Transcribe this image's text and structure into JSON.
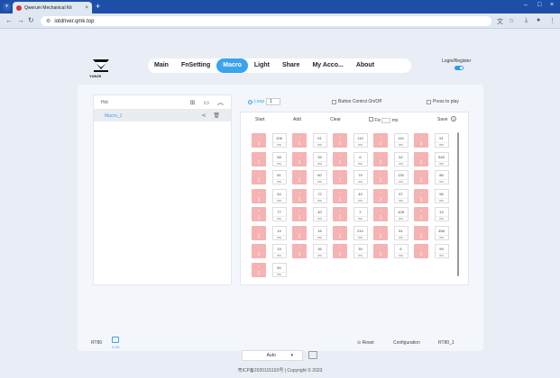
{
  "browser": {
    "tab_title": "Qwerum Mechanical Kit",
    "url": "iotdriver.qmk.top"
  },
  "header": {
    "logo_text": "YUNZII",
    "nav": [
      {
        "label": "Main",
        "active": false
      },
      {
        "label": "FnSetting",
        "active": false
      },
      {
        "label": "Macro",
        "active": true
      },
      {
        "label": "Light",
        "active": false
      },
      {
        "label": "Share",
        "active": false
      },
      {
        "label": "My Acco...",
        "active": false
      },
      {
        "label": "About",
        "active": false
      }
    ],
    "login_label": "Login/Register"
  },
  "macro_list": {
    "header_label": "Hot",
    "items": [
      {
        "name": "Macro_1"
      }
    ]
  },
  "controls": {
    "loop_label": "Loop",
    "loop_value": "1",
    "button_control_label": "Button Control On/Off",
    "press_to_play_label": "Press to play"
  },
  "toolbar": {
    "start": "Start",
    "add": "Add",
    "clear": "Clear",
    "fix": "Fix",
    "ms": "ms",
    "save": "Save",
    "help": "?"
  },
  "steps": [
    {
      "kind": "key",
      "dir": "↓",
      "key": "1"
    },
    {
      "kind": "delay",
      "value": "106",
      "unit": "ms"
    },
    {
      "kind": "key",
      "dir": "↓",
      "key": "1"
    },
    {
      "kind": "delay",
      "value": "91",
      "unit": "ms"
    },
    {
      "kind": "key",
      "dir": "↓",
      "key": "1"
    },
    {
      "kind": "delay",
      "value": "110",
      "unit": "ms"
    },
    {
      "kind": "key",
      "dir": "↓",
      "key": "1"
    },
    {
      "kind": "delay",
      "value": "110",
      "unit": "ms"
    },
    {
      "kind": "key",
      "dir": "↓",
      "key": "1"
    },
    {
      "kind": "delay",
      "value": "51",
      "unit": "ms"
    },
    {
      "kind": "key",
      "dir": "↓",
      "key": "1"
    },
    {
      "kind": "delay",
      "value": "58",
      "unit": "ms"
    },
    {
      "kind": "key",
      "dir": "↓",
      "key": "1"
    },
    {
      "kind": "delay",
      "value": "39",
      "unit": "ms"
    },
    {
      "kind": "key",
      "dir": "↓",
      "key": "1"
    },
    {
      "kind": "delay",
      "value": "6",
      "unit": "ms"
    },
    {
      "kind": "key",
      "dir": "↓",
      "key": "1"
    },
    {
      "kind": "delay",
      "value": "52",
      "unit": "ms"
    },
    {
      "kind": "key",
      "dir": "↓",
      "key": "1"
    },
    {
      "kind": "delay",
      "value": "545",
      "unit": "ms"
    },
    {
      "kind": "key",
      "dir": "↓",
      "key": "1"
    },
    {
      "kind": "delay",
      "value": "81",
      "unit": "ms"
    },
    {
      "kind": "key",
      "dir": "↓",
      "key": "1"
    },
    {
      "kind": "delay",
      "value": "60",
      "unit": "ms"
    },
    {
      "kind": "key",
      "dir": "↓",
      "key": "1"
    },
    {
      "kind": "delay",
      "value": "79",
      "unit": "ms"
    },
    {
      "kind": "key",
      "dir": "↓",
      "key": "1"
    },
    {
      "kind": "delay",
      "value": "130",
      "unit": "ms"
    },
    {
      "kind": "key",
      "dir": "↓",
      "key": "1"
    },
    {
      "kind": "delay",
      "value": "86",
      "unit": "ms"
    },
    {
      "kind": "key",
      "dir": "↓",
      "key": "1"
    },
    {
      "kind": "delay",
      "value": "54",
      "unit": "ms"
    },
    {
      "kind": "key",
      "dir": "↓",
      "key": "1"
    },
    {
      "kind": "delay",
      "value": "72",
      "unit": "ms"
    },
    {
      "kind": "key",
      "dir": "↓",
      "key": "1"
    },
    {
      "kind": "delay",
      "value": "49",
      "unit": "ms"
    },
    {
      "kind": "key",
      "dir": "↓",
      "key": "1"
    },
    {
      "kind": "delay",
      "value": "57",
      "unit": "ms"
    },
    {
      "kind": "key",
      "dir": "↓",
      "key": "1"
    },
    {
      "kind": "delay",
      "value": "56",
      "unit": "ms"
    },
    {
      "kind": "key",
      "dir": "↓",
      "key": "1"
    },
    {
      "kind": "delay",
      "value": "77",
      "unit": "ms"
    },
    {
      "kind": "key",
      "dir": "↓",
      "key": "1"
    },
    {
      "kind": "delay",
      "value": "40",
      "unit": "ms"
    },
    {
      "kind": "key",
      "dir": "↓",
      "key": "1"
    },
    {
      "kind": "delay",
      "value": "2",
      "unit": "ms"
    },
    {
      "kind": "key",
      "dir": "↓",
      "key": "1"
    },
    {
      "kind": "delay",
      "value": "108",
      "unit": "ms"
    },
    {
      "kind": "key",
      "dir": "↓",
      "key": "1"
    },
    {
      "kind": "delay",
      "value": "19",
      "unit": "ms"
    },
    {
      "kind": "key",
      "dir": "↓",
      "key": "1"
    },
    {
      "kind": "delay",
      "value": "19",
      "unit": "ms"
    },
    {
      "kind": "key",
      "dir": "↓",
      "key": "1"
    },
    {
      "kind": "delay",
      "value": "16",
      "unit": "ms"
    },
    {
      "kind": "key",
      "dir": "↓",
      "key": "1"
    },
    {
      "kind": "delay",
      "value": "210",
      "unit": "ms"
    },
    {
      "kind": "key",
      "dir": "↓",
      "key": "1"
    },
    {
      "kind": "delay",
      "value": "81",
      "unit": "ms"
    },
    {
      "kind": "key",
      "dir": "↓",
      "key": "1"
    },
    {
      "kind": "delay",
      "value": "458",
      "unit": "ms"
    },
    {
      "kind": "key",
      "dir": "↓",
      "key": "1"
    },
    {
      "kind": "delay",
      "value": "19",
      "unit": "ms"
    },
    {
      "kind": "key",
      "dir": "↓",
      "key": "1"
    },
    {
      "kind": "delay",
      "value": "36",
      "unit": "ms"
    },
    {
      "kind": "key",
      "dir": "↓",
      "key": "1"
    },
    {
      "kind": "delay",
      "value": "39",
      "unit": "ms"
    },
    {
      "kind": "key",
      "dir": "↓",
      "key": "1"
    },
    {
      "kind": "delay",
      "value": "6",
      "unit": "ms"
    },
    {
      "kind": "key",
      "dir": "↓",
      "key": "1"
    },
    {
      "kind": "delay",
      "value": "59",
      "unit": "ms"
    },
    {
      "kind": "key",
      "dir": "↓",
      "key": "1"
    },
    {
      "kind": "delay",
      "value": "50",
      "unit": "ms"
    }
  ],
  "footer": {
    "device": "RT80",
    "dongle_label": "2.4G",
    "reset": "Reset",
    "configuration": "Configuration",
    "config_value": "RT80_1",
    "language": "Auto",
    "copyright": "粤ICP备2020115193号 | Copyright © 2023"
  }
}
